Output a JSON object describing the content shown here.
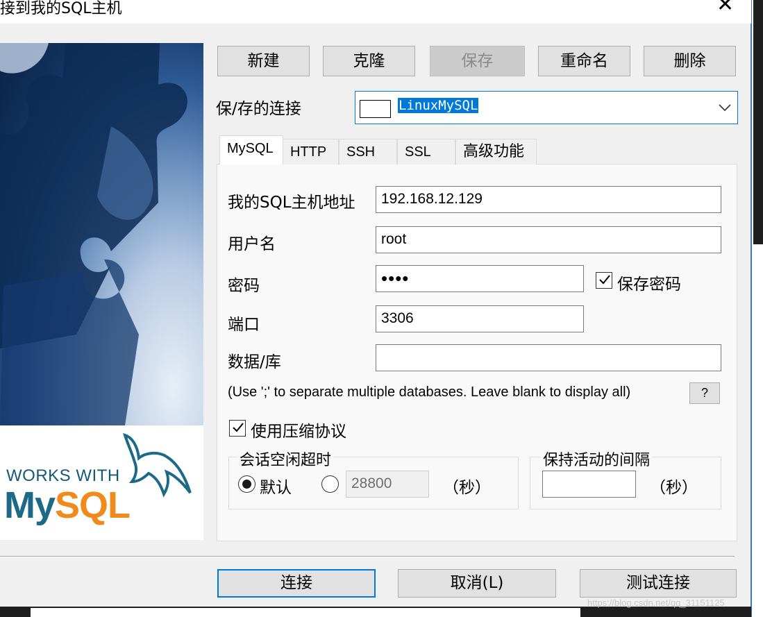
{
  "window": {
    "title": "接到我的SQL主机"
  },
  "toolbar": {
    "new": "新建",
    "clone": "克隆",
    "save": "保存",
    "rename": "重命名",
    "delete": "删除"
  },
  "saved_connection": {
    "label": "保/存的连接",
    "value": "LinuxMySQL"
  },
  "tabs": [
    "MySQL",
    "HTTP",
    "SSH",
    "SSL",
    "高级功能"
  ],
  "form": {
    "host_label": "我的SQL主机地址",
    "host_value": "192.168.12.129",
    "user_label": "用户名",
    "user_value": "root",
    "password_label": "密码",
    "password_value": "••••",
    "save_password_label": "保存密码",
    "port_label": "端口",
    "port_value": "3306",
    "database_label": "数据/库",
    "database_value": "",
    "database_hint": "(Use ';' to separate multiple databases. Leave blank to display all)",
    "help_label": "?",
    "compress_label": "使用压缩协议"
  },
  "session_timeout": {
    "title": "会话空闲超时",
    "default_label": "默认",
    "custom_value": "28800",
    "unit": "（秒）"
  },
  "keepalive": {
    "title": "保持活动的间隔",
    "value": "",
    "unit": "（秒）"
  },
  "footer": {
    "connect": "连接",
    "cancel": "取消(L)",
    "test": "测试连接"
  },
  "banner": {
    "works_with": "WORKS WITH",
    "logo_my": "My",
    "logo_sql": "SQL"
  },
  "watermark": "https://blog.csdn.net/qq_31151125",
  "colors": {
    "accent": "#0078d7",
    "mysql_blue": "#1c6a88",
    "mysql_orange": "#f08a1c"
  }
}
